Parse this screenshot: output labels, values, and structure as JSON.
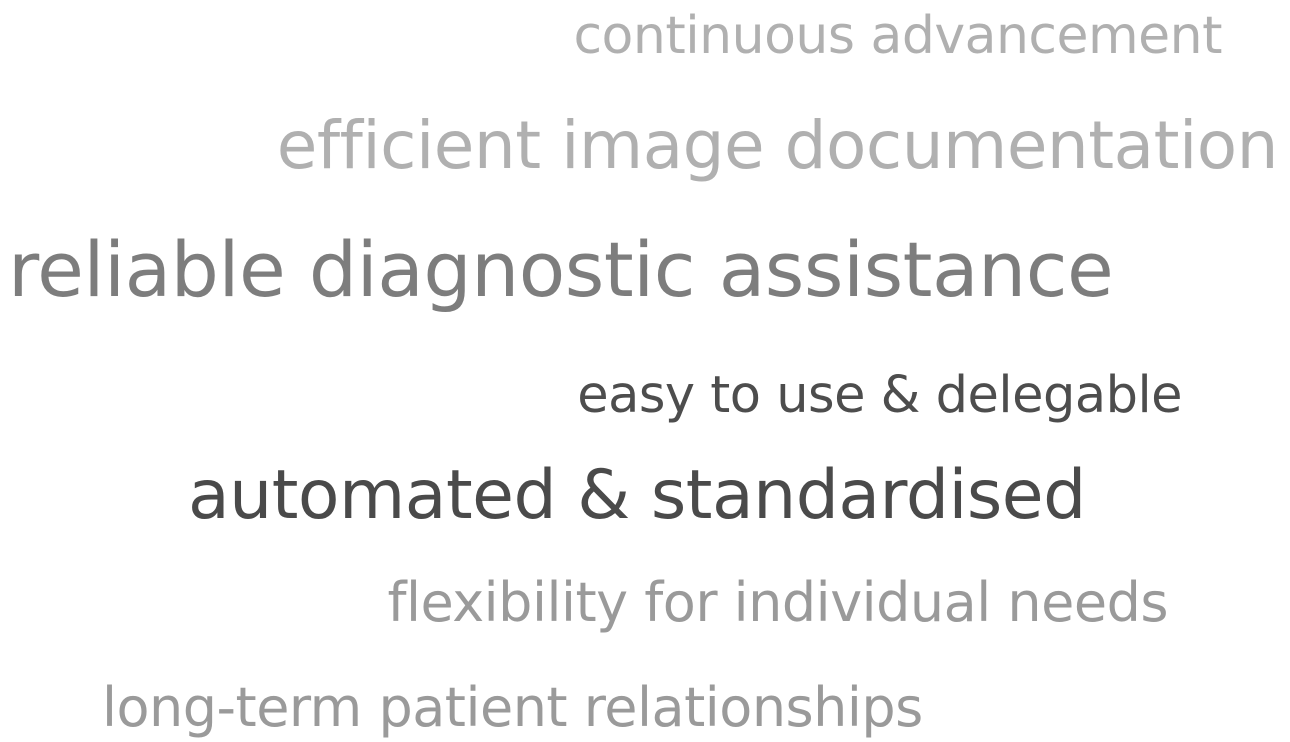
{
  "phrases": [
    {
      "text": "continuous advancement",
      "color": "#b0b0b0"
    },
    {
      "text": "efficient image documentation",
      "color": "#b0b0b0"
    },
    {
      "text": "reliable diagnostic assistance",
      "color": "#7d7d7d"
    },
    {
      "text": "easy to use & delegable",
      "color": "#4d4d4d"
    },
    {
      "text": "automated & standardised",
      "color": "#4a4a4a"
    },
    {
      "text": "flexibility for individual needs",
      "color": "#9a9a9a"
    },
    {
      "text": "long-term patient relationships",
      "color": "#9a9a9a"
    }
  ]
}
